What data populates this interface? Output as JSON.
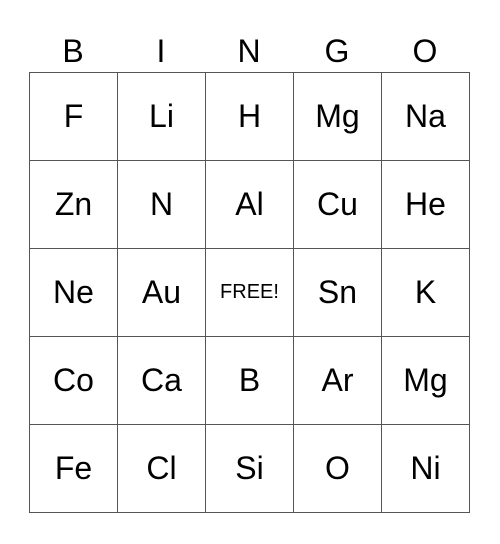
{
  "header": [
    "B",
    "I",
    "N",
    "G",
    "O"
  ],
  "rows": [
    [
      "F",
      "Li",
      "H",
      "Mg",
      "Na"
    ],
    [
      "Zn",
      "N",
      "Al",
      "Cu",
      "He"
    ],
    [
      "Ne",
      "Au",
      "FREE!",
      "Sn",
      "K"
    ],
    [
      "Co",
      "Ca",
      "B",
      "Ar",
      "Mg"
    ],
    [
      "Fe",
      "Cl",
      "Si",
      "O",
      "Ni"
    ]
  ]
}
